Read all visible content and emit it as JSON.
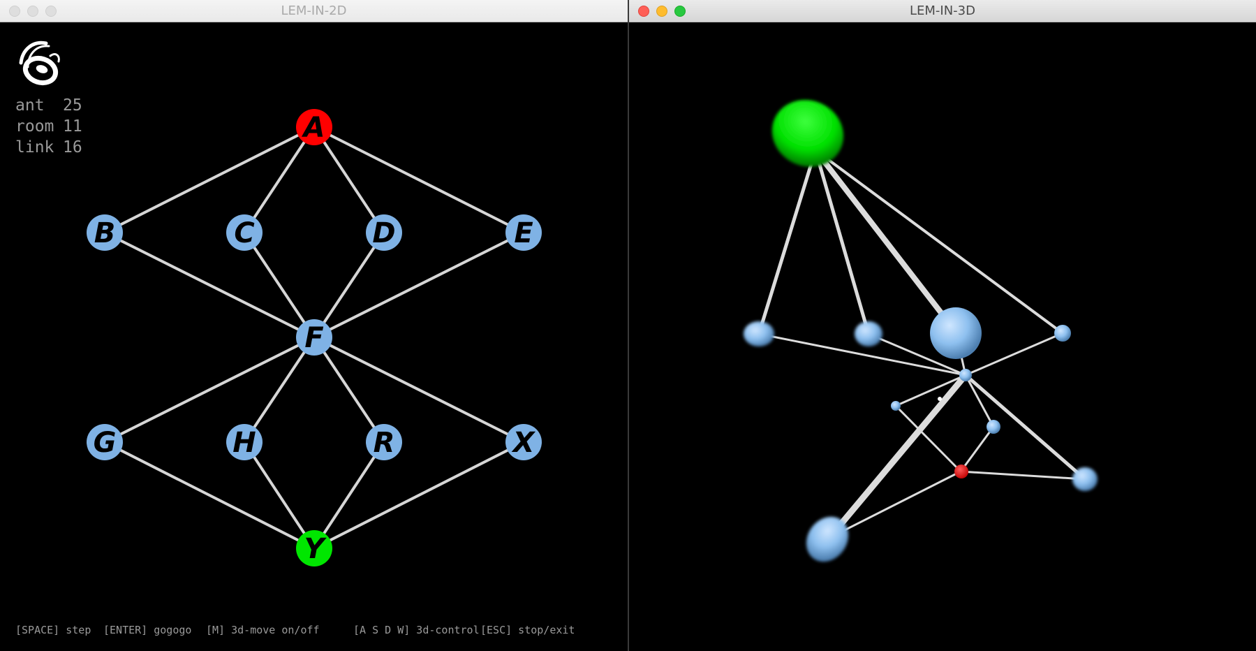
{
  "windows": {
    "left": {
      "title": "LEM-IN-2D"
    },
    "right": {
      "title": "LEM-IN-3D"
    }
  },
  "logo": {
    "icon": "ant-logo-icon"
  },
  "stats": [
    {
      "label": "ant",
      "value": "25"
    },
    {
      "label": "room",
      "value": "11"
    },
    {
      "label": "link",
      "value": "16"
    }
  ],
  "graph": {
    "nodes": [
      {
        "id": "A",
        "role": "start",
        "color": "#ff0000"
      },
      {
        "id": "B",
        "role": "room",
        "color": "#7fb2e5"
      },
      {
        "id": "C",
        "role": "room",
        "color": "#7fb2e5"
      },
      {
        "id": "D",
        "role": "room",
        "color": "#7fb2e5"
      },
      {
        "id": "E",
        "role": "room",
        "color": "#7fb2e5"
      },
      {
        "id": "F",
        "role": "room",
        "color": "#7fb2e5"
      },
      {
        "id": "G",
        "role": "room",
        "color": "#7fb2e5"
      },
      {
        "id": "H",
        "role": "room",
        "color": "#7fb2e5"
      },
      {
        "id": "R",
        "role": "room",
        "color": "#7fb2e5"
      },
      {
        "id": "X",
        "role": "room",
        "color": "#7fb2e5"
      },
      {
        "id": "Y",
        "role": "end",
        "color": "#00e600"
      }
    ],
    "links": [
      [
        "A",
        "B"
      ],
      [
        "A",
        "C"
      ],
      [
        "A",
        "D"
      ],
      [
        "A",
        "E"
      ],
      [
        "B",
        "F"
      ],
      [
        "C",
        "F"
      ],
      [
        "D",
        "F"
      ],
      [
        "E",
        "F"
      ],
      [
        "F",
        "G"
      ],
      [
        "F",
        "H"
      ],
      [
        "F",
        "R"
      ],
      [
        "F",
        "X"
      ],
      [
        "G",
        "Y"
      ],
      [
        "H",
        "Y"
      ],
      [
        "R",
        "Y"
      ],
      [
        "X",
        "Y"
      ]
    ],
    "link_color": "#d6d6d6"
  },
  "help": {
    "step": "[SPACE] step",
    "go": "[ENTER] gogogo",
    "move": "[M] 3d-move on/off",
    "control": "[A S D W] 3d-control",
    "exit": "[ESC] stop/exit"
  }
}
